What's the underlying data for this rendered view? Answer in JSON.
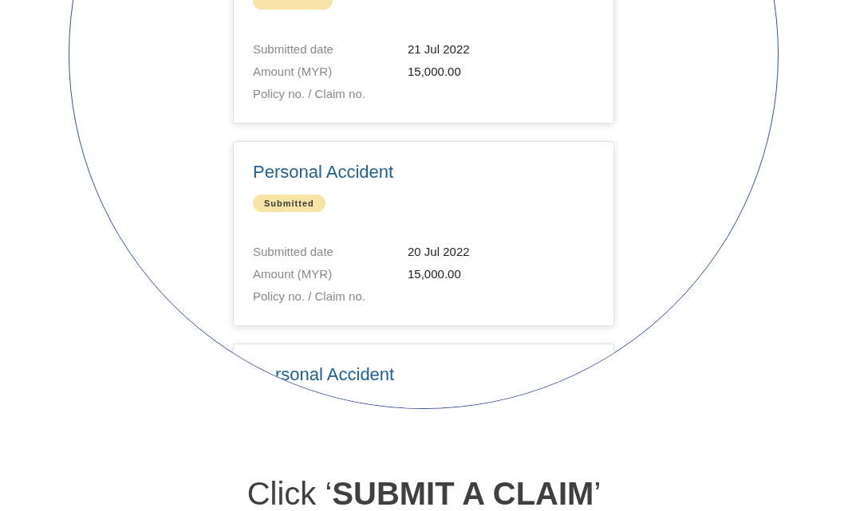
{
  "magnifier": {
    "cards": [
      {
        "badge": true,
        "details": [
          {
            "label": "Submitted date",
            "value": "21 Jul 2022"
          },
          {
            "label": "Amount (MYR)",
            "value": "15,000.00"
          },
          {
            "label": "Policy no. / Claim no."
          }
        ]
      },
      {
        "title": "Personal Accident",
        "status": "Submitted",
        "details": [
          {
            "label": "Submitted date",
            "value": "20 Jul 2022"
          },
          {
            "label": "Amount (MYR)",
            "value": "15,000.00"
          },
          {
            "label": "Policy no. / Claim no."
          }
        ]
      },
      {
        "title": "rsonal Accident"
      }
    ]
  },
  "caption": "Click ‘**SUBMIT A CLAIM**’"
}
